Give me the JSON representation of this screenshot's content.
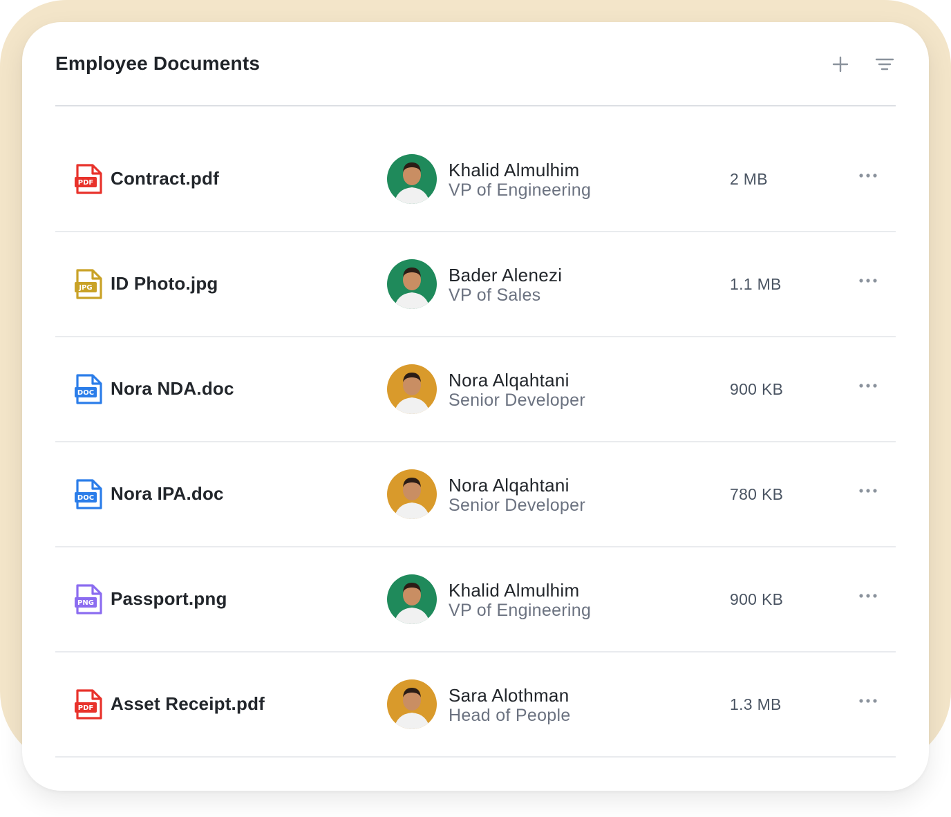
{
  "header": {
    "title": "Employee Documents",
    "add_icon": "plus-icon",
    "filter_icon": "filter-lines-icon"
  },
  "documents": [
    {
      "file_name": "Contract.pdf",
      "type_label": "PDF",
      "type_color": "#e8322b",
      "person": {
        "name": "Khalid Almulhim",
        "role": "VP of Engineering",
        "avatar_bg": "#1f8a5b"
      },
      "size": "2 MB"
    },
    {
      "file_name": "ID Photo.jpg",
      "type_label": "JPG",
      "type_color": "#c9a227",
      "person": {
        "name": "Bader Alenezi",
        "role": "VP of Sales",
        "avatar_bg": "#1f8a5b"
      },
      "size": "1.1 MB"
    },
    {
      "file_name": "Nora NDA.doc",
      "type_label": "DOC",
      "type_color": "#2b7de9",
      "person": {
        "name": "Nora Alqahtani",
        "role": "Senior Developer",
        "avatar_bg": "#d99a2b"
      },
      "size": "900 KB"
    },
    {
      "file_name": "Nora IPA.doc",
      "type_label": "DOC",
      "type_color": "#2b7de9",
      "person": {
        "name": "Nora Alqahtani",
        "role": "Senior Developer",
        "avatar_bg": "#d99a2b"
      },
      "size": "780 KB"
    },
    {
      "file_name": "Passport.png",
      "type_label": "PNG",
      "type_color": "#8b6cf0",
      "person": {
        "name": "Khalid Almulhim",
        "role": "VP of Engineering",
        "avatar_bg": "#1f8a5b"
      },
      "size": "900 KB"
    },
    {
      "file_name": "Asset Receipt.pdf",
      "type_label": "PDF",
      "type_color": "#e8322b",
      "person": {
        "name": "Sara Alothman",
        "role": "Head of People",
        "avatar_bg": "#d99a2b"
      },
      "size": "1.3 MB"
    }
  ],
  "row_action_icon": "more-horizontal-icon",
  "colors": {
    "frame": "#f3e5c9",
    "card": "#ffffff",
    "divider": "#e9ebee"
  }
}
